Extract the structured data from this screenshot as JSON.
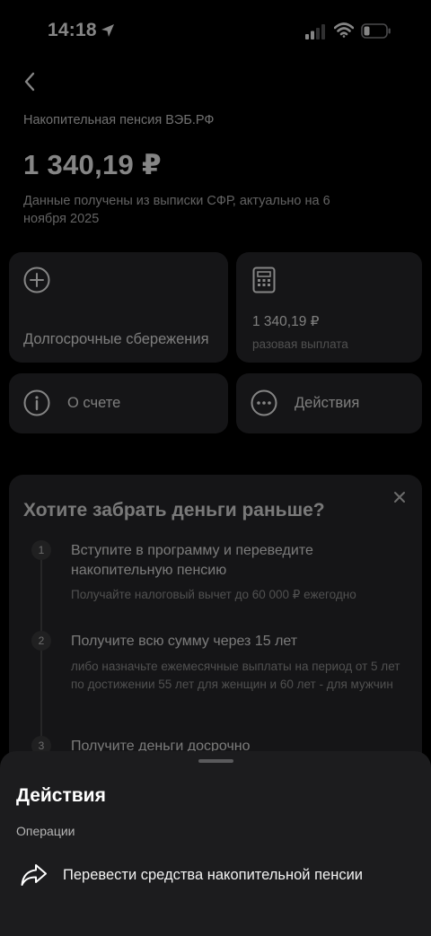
{
  "status_bar": {
    "time": "14:18",
    "icons": [
      "location-arrow-icon",
      "cellular-signal-icon",
      "wifi-icon",
      "battery-low-icon"
    ]
  },
  "header": {
    "back_icon": "chevron-left-icon",
    "account_title": "Накопительная пенсия ВЭБ.РФ",
    "balance": "1 340,19 ₽",
    "data_note": "Данные получены из выписки СФР, актуально на 6 ноября 2025"
  },
  "tiles": {
    "long_term": {
      "icon": "plus-circle-icon",
      "label": "Долгосрочные сбережения"
    },
    "payout": {
      "icon": "calculator-icon",
      "amount": "1 340,19 ₽",
      "label": "разовая выплата"
    },
    "about": {
      "icon": "info-circle-icon",
      "label": "О счете"
    },
    "actions": {
      "icon": "more-circle-icon",
      "label": "Действия"
    }
  },
  "promo": {
    "title": "Хотите забрать деньги раньше?",
    "close_icon": "close-icon",
    "steps": [
      {
        "num": "1",
        "title": "Вступите в программу и переведите накопительную пенсию",
        "desc": "Получайте налоговый вычет до 60 000 ₽ ежегодно"
      },
      {
        "num": "2",
        "title": "Получите всю сумму через 15 лет",
        "desc": "либо назначьте ежемесячные выплаты на период от 5 лет по достижении 55 лет для женщин и 60 лет - для мужчин"
      },
      {
        "num": "3",
        "title": "Получите деньги досрочно",
        "desc": ""
      }
    ]
  },
  "sheet": {
    "title": "Действия",
    "section": "Операции",
    "items": [
      {
        "icon": "share-arrow-icon",
        "label": "Перевести средства накопительной пенсии"
      }
    ]
  },
  "colors": {
    "background": "#000000",
    "tile": "#2a2a2c",
    "sheet": "#1c1c1e",
    "muted_text": "#9a9a9a"
  }
}
